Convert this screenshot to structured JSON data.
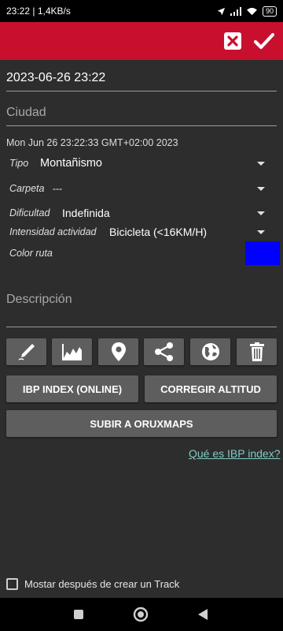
{
  "status_bar": {
    "time_and_speed": "23:22 | 1,4KB/s",
    "battery": "90"
  },
  "toolbar": {
    "close_icon": "x-square-icon",
    "confirm_icon": "check-icon"
  },
  "form": {
    "date_value": "2023-06-26 23:22",
    "city_placeholder": "Ciudad",
    "timestamp": "Mon Jun 26 23:22:33 GMT+02:00 2023",
    "tipo_label": "Tipo",
    "tipo_value": "Montañismo",
    "carpeta_label": "Carpeta",
    "carpeta_value": "---",
    "dificultad_label": "Dificultad",
    "dificultad_value": "Indefinida",
    "intensidad_label": "Intensidad actividad",
    "intensidad_value": "Bicicleta (<16KM/H)",
    "color_label": "Color ruta",
    "color_value": "#0000ff",
    "description_placeholder": "Descripción"
  },
  "icon_buttons": [
    "pen-icon",
    "chart-icon",
    "map-pin-icon",
    "share-icon",
    "globe-icon",
    "trash-icon"
  ],
  "buttons": {
    "ibp_index": "IBP INDEX (ONLINE)",
    "corregir_altitud": "CORREGIR ALTITUD",
    "subir_oruxmaps": "SUBIR A ORUXMAPS"
  },
  "help_link": "Qué es IBP index?",
  "checkbox": {
    "label": "Mostar después de crear un Track",
    "checked": false
  },
  "colors": {
    "toolbar": "#c8102e",
    "background": "#2d2d2d",
    "button": "#5e5e5e",
    "link": "#80cbc4"
  }
}
